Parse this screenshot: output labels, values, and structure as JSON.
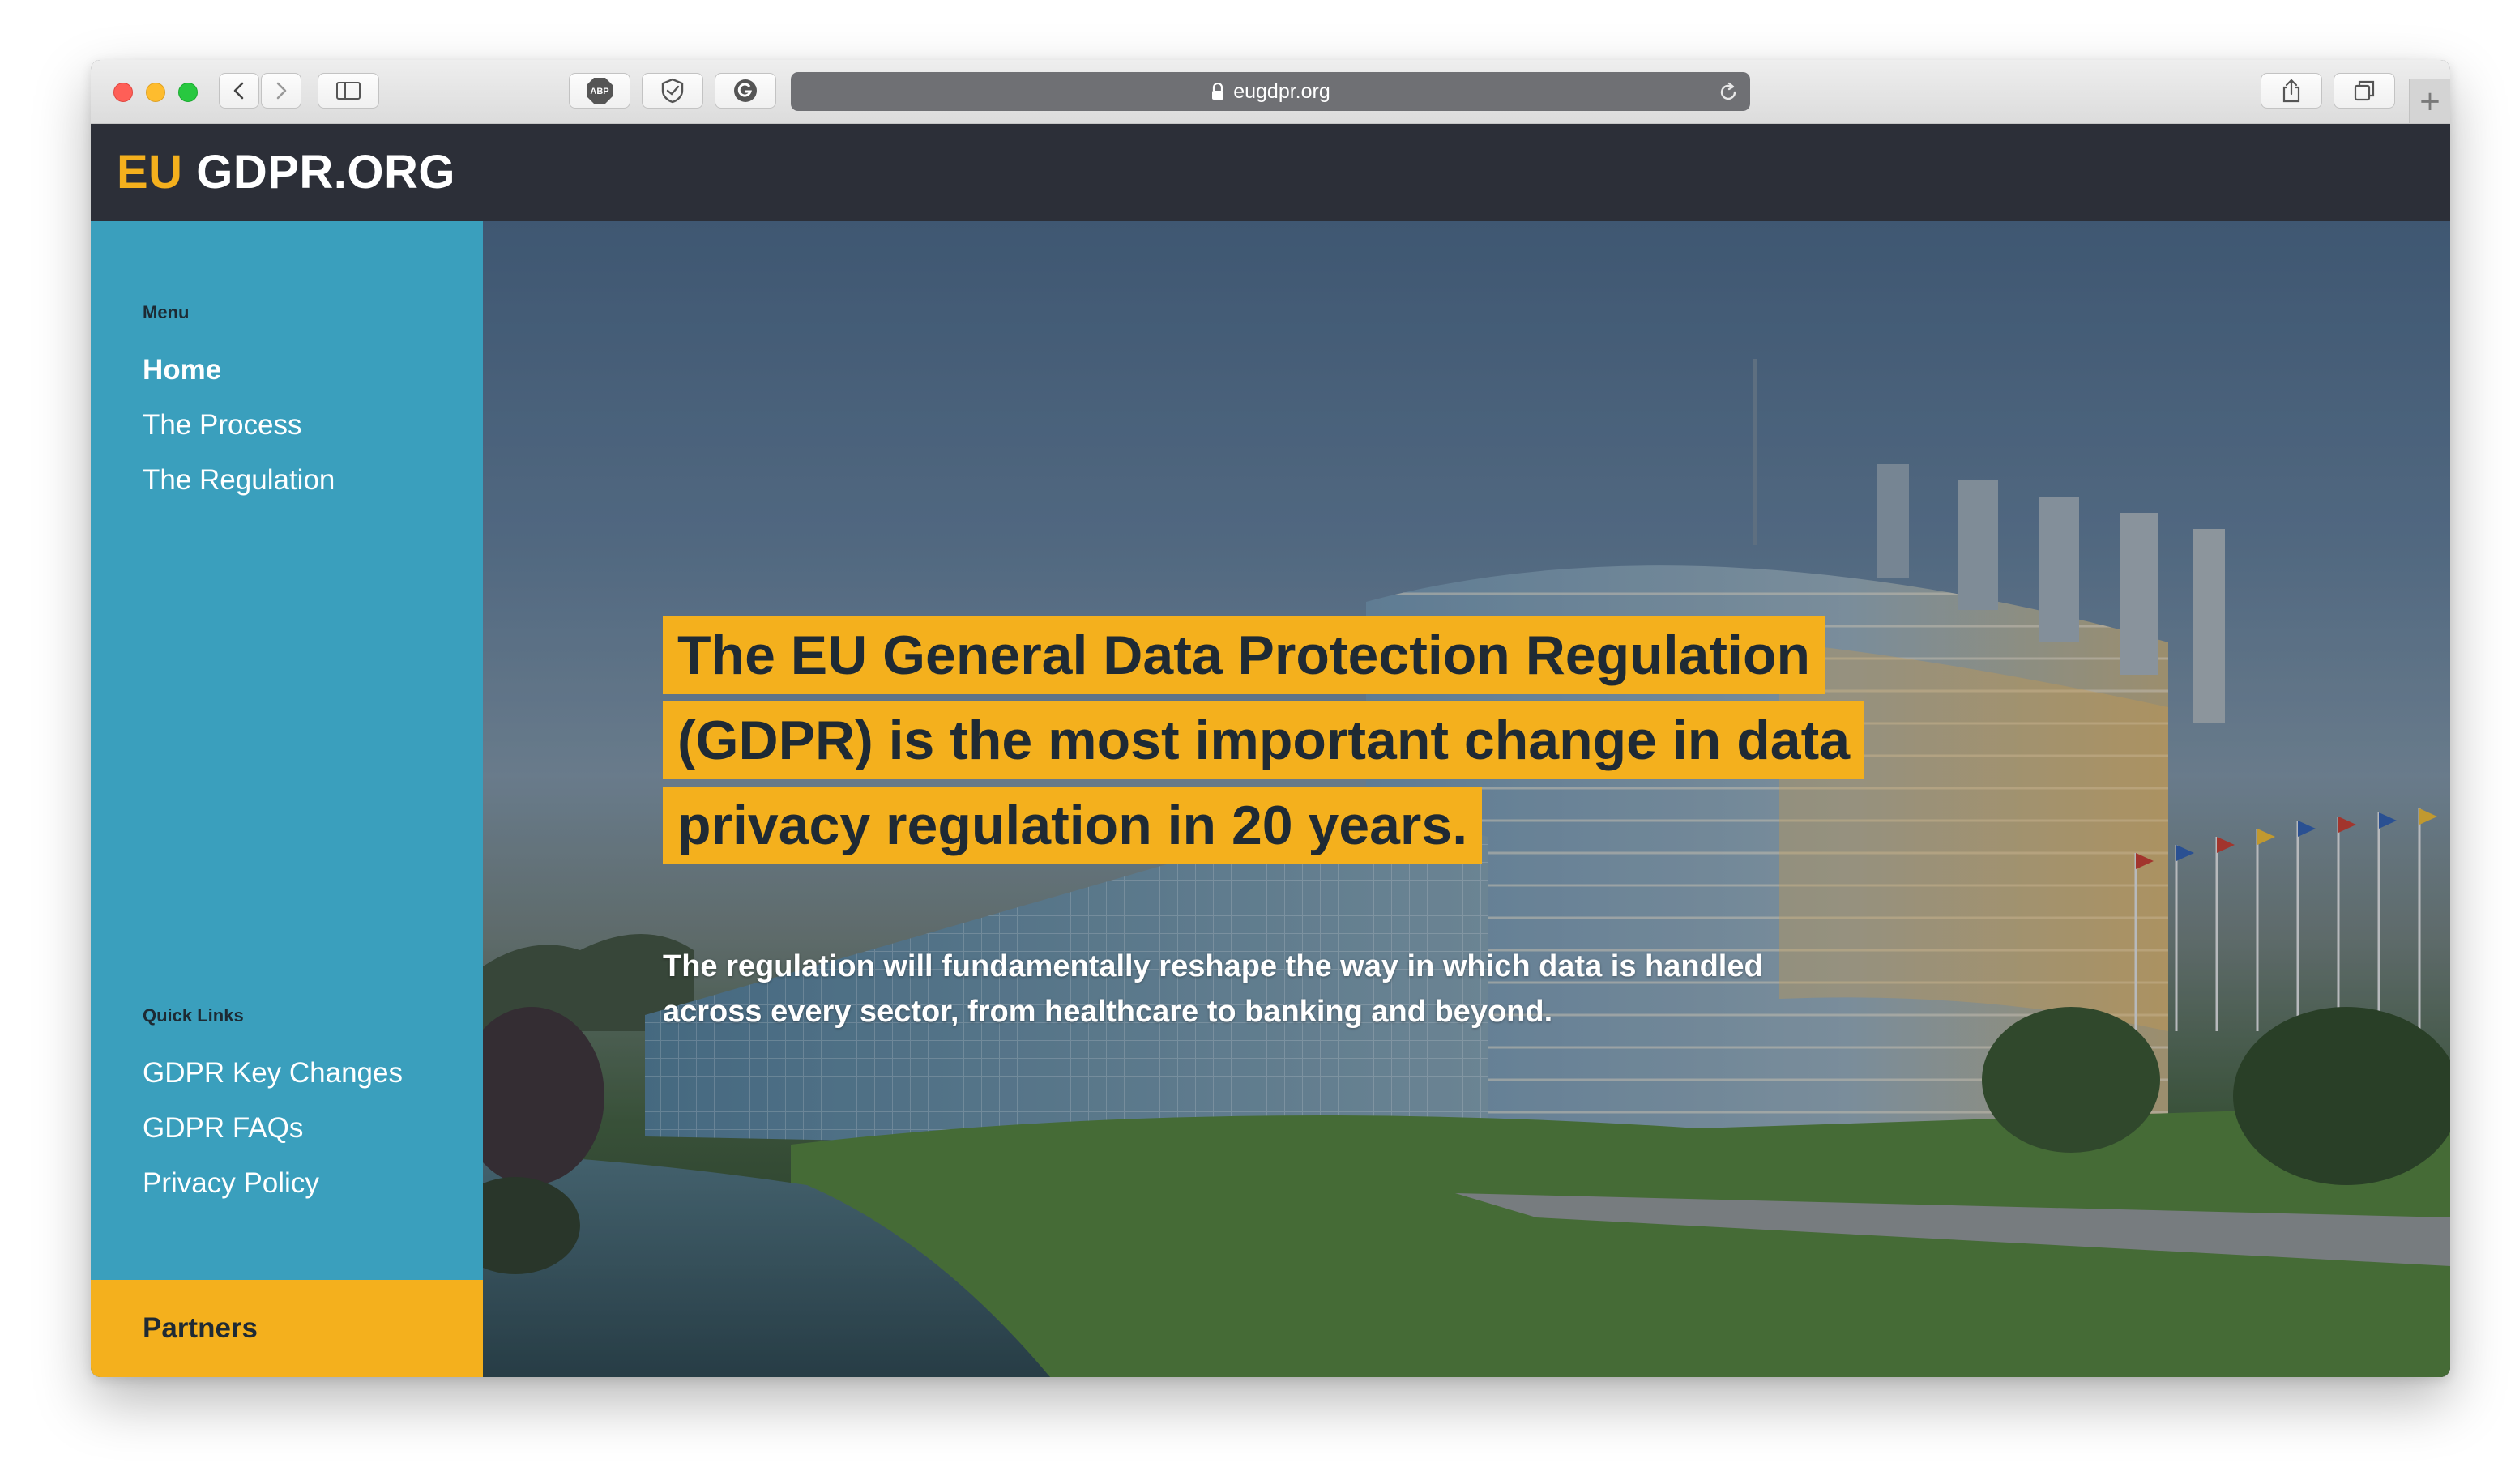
{
  "browser": {
    "url": "eugdpr.org",
    "extensions": [
      "adblock-icon",
      "shield-icon",
      "grammarly-icon"
    ]
  },
  "site": {
    "logo_prefix": "EU",
    "logo_main": "GDPR.ORG"
  },
  "sidebar": {
    "menu_label": "Menu",
    "menu_items": [
      {
        "label": "Home",
        "active": true
      },
      {
        "label": "The Process",
        "active": false
      },
      {
        "label": "The Regulation",
        "active": false
      }
    ],
    "quick_links_label": "Quick Links",
    "quick_links": [
      {
        "label": "GDPR Key Changes"
      },
      {
        "label": "GDPR FAQs"
      },
      {
        "label": "Privacy Policy"
      }
    ],
    "partners_label": "Partners"
  },
  "hero": {
    "headline": "The EU General Data Protection Regulation (GDPR) is the most important change in data privacy regulation in 20 years.",
    "subtext": "The regulation will fundamentally reshape the way in which data is handled across every sector, from healthcare to banking and beyond."
  },
  "colors": {
    "accent": "#f4b01d",
    "sidebar": "#3a9fbd",
    "header": "#2c2f38"
  }
}
